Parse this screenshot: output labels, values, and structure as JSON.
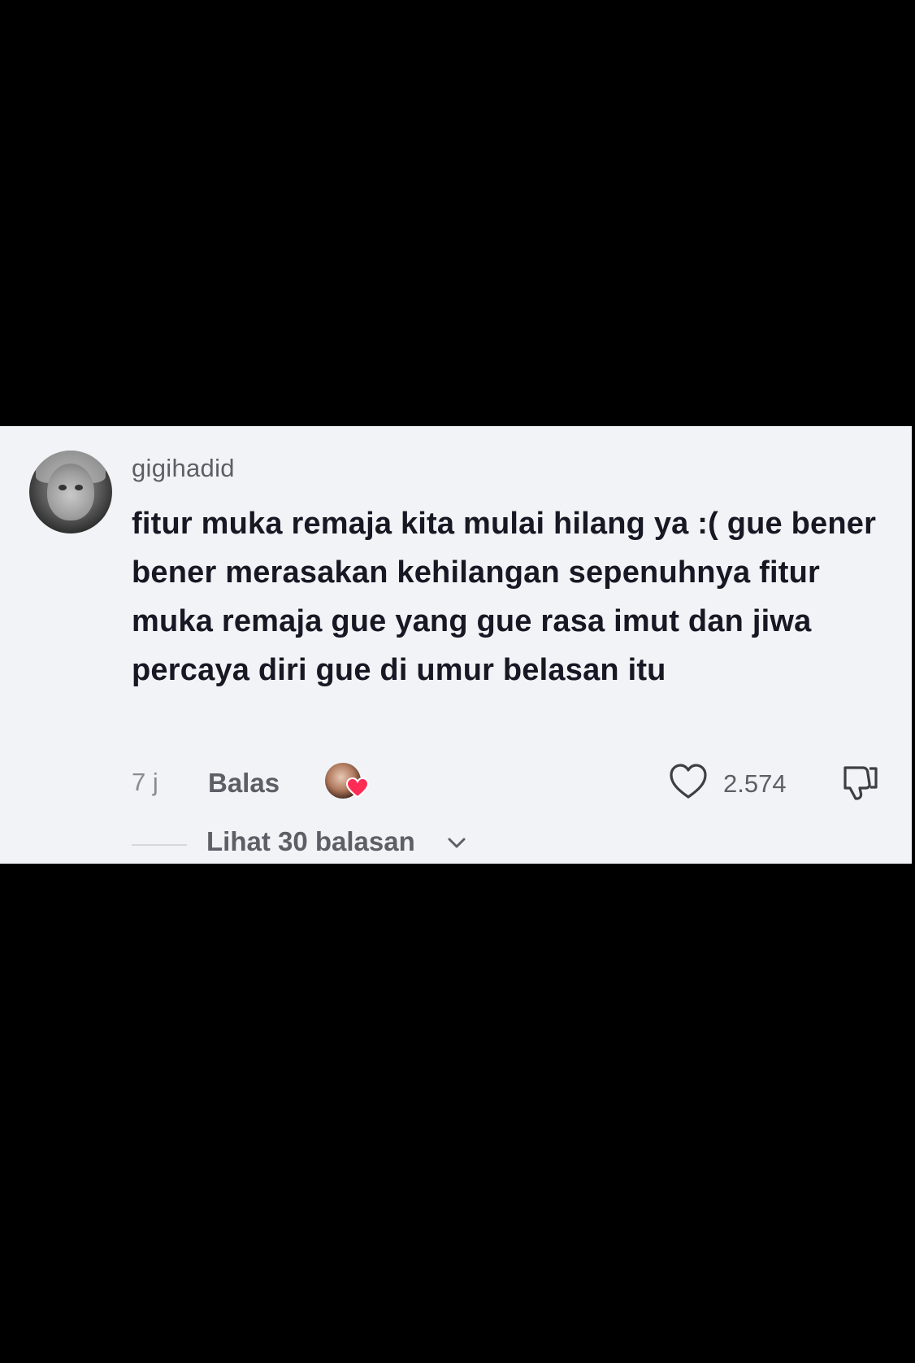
{
  "comment": {
    "username": "gigihadid",
    "text": "fitur muka remaja kita mulai hilang ya :( gue bener bener merasakan kehilangan sepenuhnya fitur muka remaja gue yang gue rasa imut dan jiwa percaya diri gue di umur belasan itu",
    "timestamp": "7 j",
    "reply_label": "Balas",
    "like_count": "2.574",
    "view_replies_label": "Lihat 30 balasan",
    "icons": {
      "avatar": "avatar",
      "creator_liked": "creator-liked-avatar",
      "heart_badge": "heart-icon",
      "like": "heart-outline-icon",
      "dislike": "thumbs-down-icon",
      "expand": "chevron-down-icon"
    }
  },
  "colors": {
    "background": "#000000",
    "card": "#f1f3f6",
    "text_primary": "#161823",
    "text_secondary": "#5c5f66",
    "text_muted": "#8a8b91",
    "heart_badge": "#fe2c55"
  }
}
